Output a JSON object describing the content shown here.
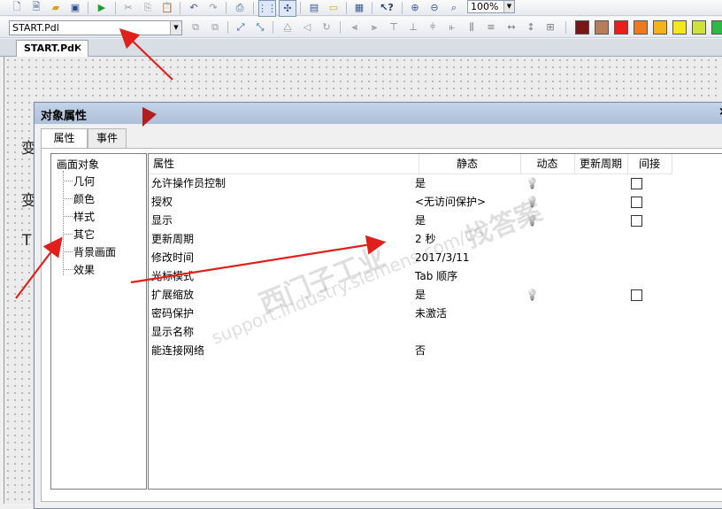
{
  "toolbar": {
    "zoom_value": "100%",
    "object_selector_value": "START.Pdl"
  },
  "document_tab": {
    "label": "START.Pdl",
    "close_glyph": "✕"
  },
  "canvas_texts": [
    "变",
    "变",
    "T"
  ],
  "dialog": {
    "title": "对象属性",
    "close_glyph": "×",
    "tabs": [
      {
        "label": "属性",
        "active": true
      },
      {
        "label": "事件",
        "active": false
      }
    ],
    "tree": {
      "root": "画面对象",
      "children": [
        "几何",
        "颜色",
        "样式",
        "其它",
        "背景画面",
        "效果"
      ]
    },
    "grid": {
      "headers": {
        "property": "属性",
        "static": "静态",
        "dynamic": "动态",
        "update": "更新周期",
        "indirect": "间接"
      },
      "rows": [
        {
          "name": "允许操作员控制",
          "static": "是",
          "dynamic": true,
          "indirect": true
        },
        {
          "name": "授权",
          "static": "<无访问保护>",
          "dynamic": true,
          "indirect": true
        },
        {
          "name": "显示",
          "static": "是",
          "dynamic": true,
          "indirect": true
        },
        {
          "name": "更新周期",
          "static": "2 秒",
          "dynamic": false,
          "indirect": false
        },
        {
          "name": "修改时间",
          "static": "2017/3/11",
          "dynamic": false,
          "indirect": false
        },
        {
          "name": "光标模式",
          "static": "Tab 顺序",
          "dynamic": false,
          "indirect": false
        },
        {
          "name": "扩展缩放",
          "static": "是",
          "dynamic": true,
          "indirect": true
        },
        {
          "name": "密码保护",
          "static": "未激活",
          "dynamic": false,
          "indirect": false
        },
        {
          "name": "显示名称",
          "static": "",
          "dynamic": false,
          "indirect": false
        },
        {
          "name": "能连接网络",
          "static": "否",
          "dynamic": false,
          "indirect": false
        }
      ]
    }
  },
  "watermark": {
    "brand": "西门子工业",
    "brand2": "找答案",
    "url": "support.industry.siemens.com/cs"
  },
  "colors": {
    "annotation_arrow": "#e0201c",
    "title_bar": "#b7c8df"
  },
  "swatches": [
    "#7b1616",
    "#b87c5a",
    "#e81d1d",
    "#ee7a20",
    "#f5b21a",
    "#f5e81a",
    "#cfe23a",
    "#2fb84a"
  ]
}
